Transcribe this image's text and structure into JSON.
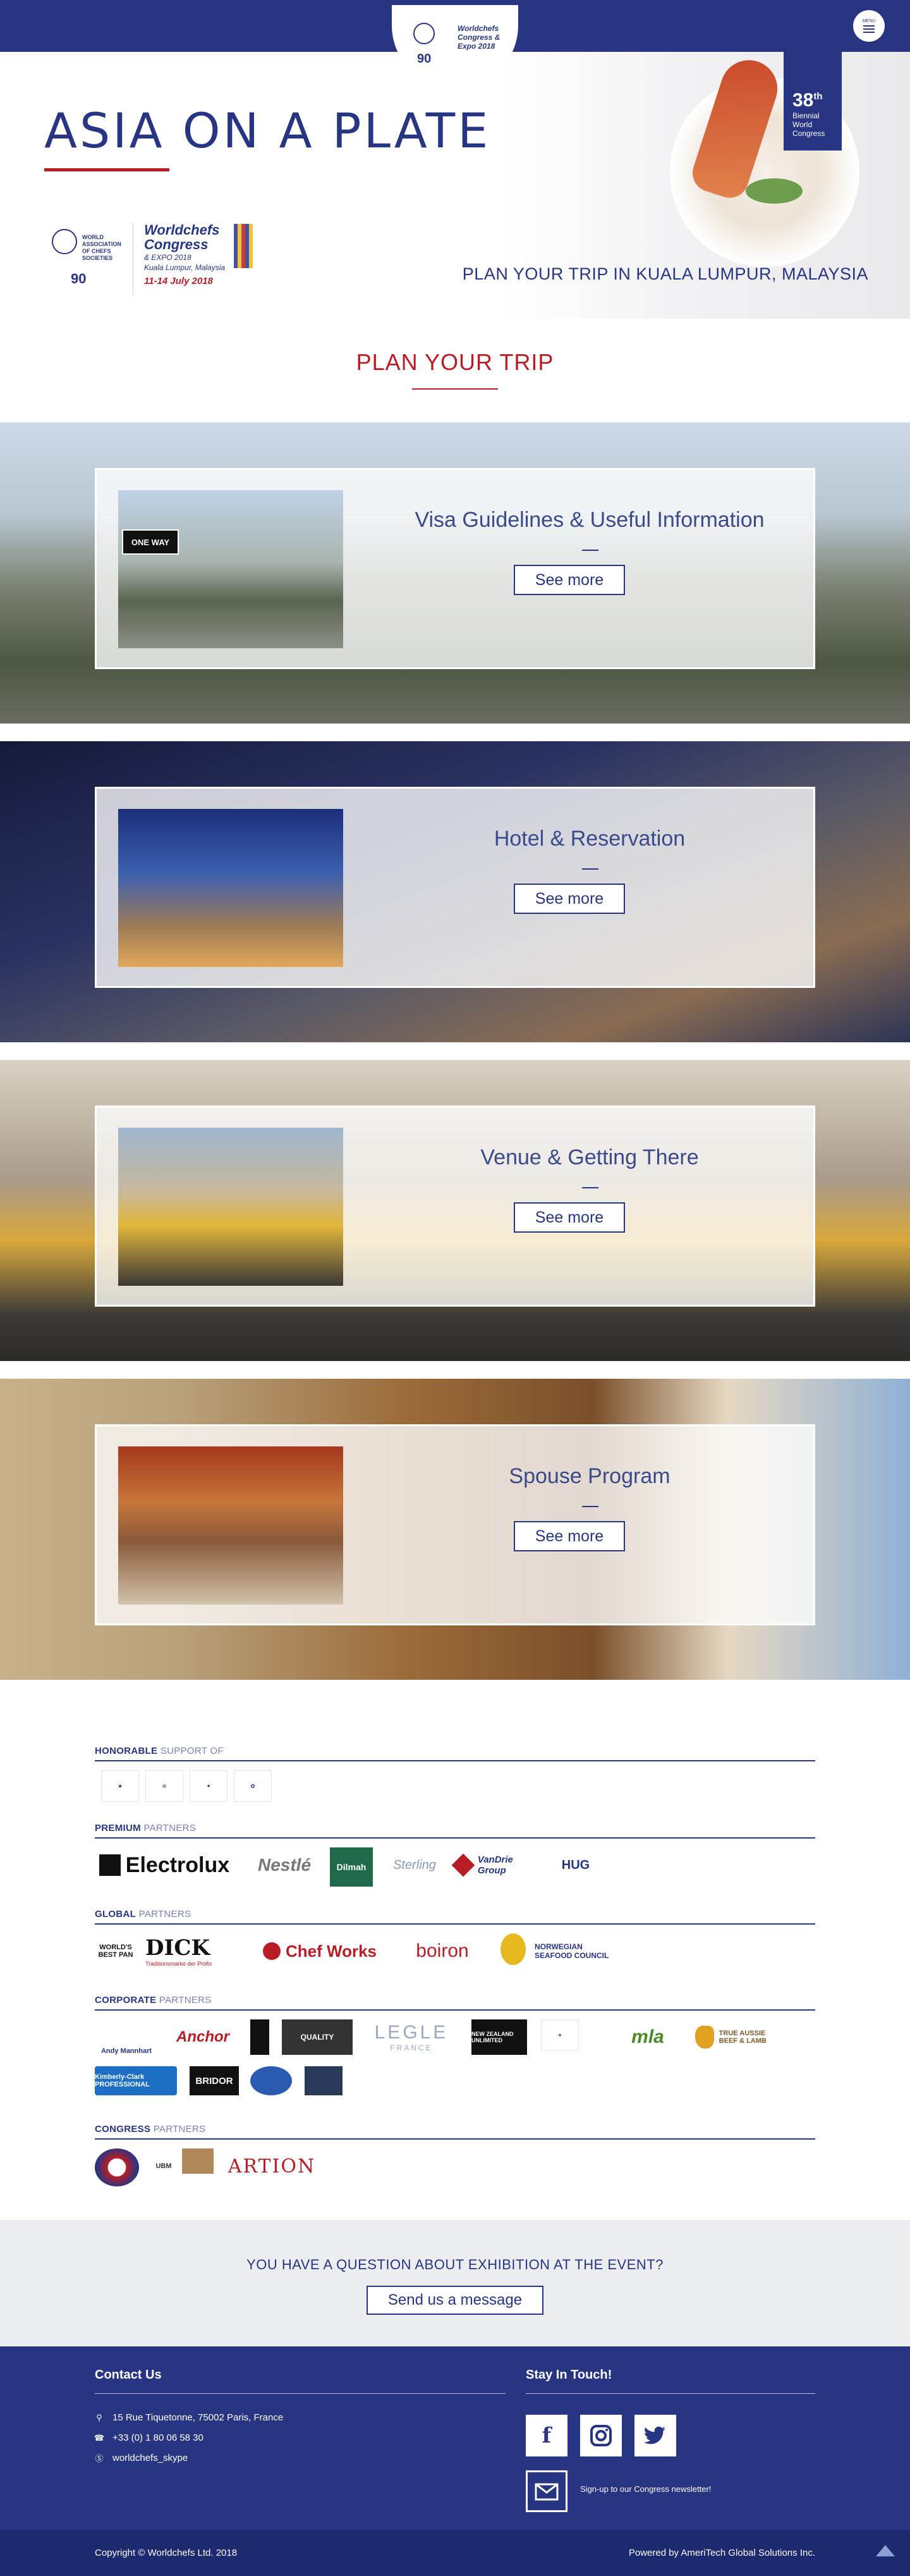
{
  "nav": {
    "logo_text": "Worldchefs Congress & Expo 2018",
    "logo_date": "11-14 July 2018",
    "logo_number": "90",
    "menu_label": "MENU"
  },
  "hero": {
    "title": "ASIA ON A PLATE",
    "subtitle": "PLAN YOUR TRIP IN KUALA LUMPUR, MALAYSIA",
    "badge_number": "38",
    "badge_suffix": "th",
    "badge_lines": [
      "Biennial",
      "World",
      "Congress"
    ],
    "wacs_text": "WORLD ASSOCIATION OF CHEFS SOCIETIES",
    "wacs_number": "90",
    "congress_title": "Worldchefs Congress",
    "congress_expo": "& EXPO 2018",
    "congress_place": "Kuala Lumpur, Malaysia",
    "congress_date": "11-14 July 2018"
  },
  "section": {
    "title": "PLAN YOUR TRIP"
  },
  "trips": [
    {
      "title": "Visa Guidelines & Useful Information",
      "button": "See more",
      "thumb_sign": "ONE WAY"
    },
    {
      "title": "Hotel & Reservation",
      "button": "See more"
    },
    {
      "title": "Venue & Getting There",
      "button": "See more"
    },
    {
      "title": "Spouse Program",
      "button": "See more"
    }
  ],
  "sponsors": {
    "honorable": {
      "bold": "HONORABLE",
      "light": "SUPPORT OF"
    },
    "premium": {
      "bold": "PREMIUM",
      "light": "PARTNERS",
      "logos": [
        "Electrolux",
        "Nestlé",
        "Dilmah",
        "Sterling",
        "VanDrie Group",
        "HUG"
      ]
    },
    "global": {
      "bold": "GLOBAL",
      "light": "PARTNERS",
      "logos": [
        "WORLD'S BEST PAN",
        "DICK",
        "Traditionsmarke der Profis",
        "Chef Works",
        "boiron",
        "NORWEGIAN SEAFOOD COUNCIL"
      ]
    },
    "corporate": {
      "bold": "CORPORATE",
      "light": "PARTNERS",
      "logos": [
        "Andy Mannhart",
        "Anchor",
        "QUALITY",
        "LEGLE",
        "FRANCE",
        "NEW ZEALAND UNLIMITED",
        "mla",
        "TRUE AUSSIE BEEF & LAMB",
        "Kimberly-Clark PROFESSIONAL",
        "BRIDOR"
      ]
    },
    "congress": {
      "bold": "CONGRESS",
      "light": "PARTNERS",
      "logos": [
        "UBM",
        "ARTION"
      ]
    }
  },
  "ask": {
    "question": "YOU HAVE A QUESTION ABOUT EXHIBITION AT THE EVENT?",
    "button": "Send us a message"
  },
  "footer": {
    "contact_title": "Contact Us",
    "address": "15 Rue Tiquetonne, 75002 Paris, France",
    "phone": "+33 (0) 1 80 06 58 30",
    "skype": "worldchefs_skype",
    "stay_title": "Stay In Touch!",
    "newsletter": "Sign-up to our Congress newsletter!",
    "copyright": "Copyright © Worldchefs Ltd. 2018",
    "powered": "Powered by AmeriTech Global Solutions Inc."
  },
  "colors": {
    "brand_blue": "#283583",
    "accent_red": "#b81d25",
    "band_grey": "#ecedf1"
  }
}
